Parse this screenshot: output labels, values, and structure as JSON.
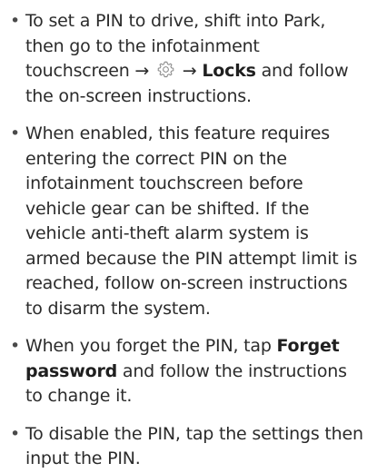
{
  "bullet_char": "•",
  "items": [
    {
      "text_before": "To set a PIN to drive, shift into Park, then go to the infotainment touchscreen → ",
      "icon": "gear-icon",
      "text_mid": " → ",
      "bold": "Locks",
      "text_after": " and follow the on-screen instructions."
    },
    {
      "text": "When enabled, this feature requires entering the correct PIN on the infotainment touchscreen before vehicle gear can be shifted. If the vehicle anti-theft alarm system is armed because the PIN attempt limit is reached, follow on-screen instructions to disarm the system."
    },
    {
      "text_before": "When you forget the PIN, tap ",
      "bold": "Forget password",
      "text_after": " and follow the instructions to change it."
    },
    {
      "text": "To disable the PIN, tap the settings then input the PIN."
    }
  ]
}
